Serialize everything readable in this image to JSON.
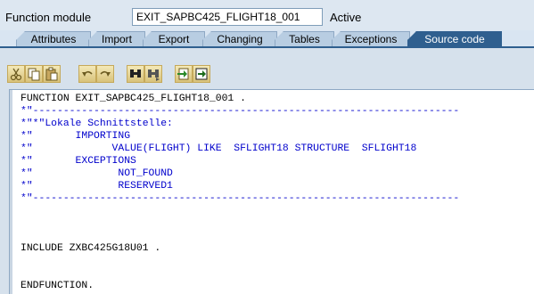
{
  "header": {
    "function_module_label": "Function module",
    "function_module_value": "EXIT_SAPBC425_FLIGHT18_001",
    "status": "Active"
  },
  "tabs": [
    {
      "label": "Attributes"
    },
    {
      "label": "Import"
    },
    {
      "label": "Export"
    },
    {
      "label": "Changing"
    },
    {
      "label": "Tables"
    },
    {
      "label": "Exceptions"
    },
    {
      "label": "Source code",
      "active": true
    }
  ],
  "toolbar": {
    "buttons": [
      "cut-icon",
      "copy-icon",
      "paste-icon",
      "undo-icon",
      "redo-icon",
      "find-icon",
      "find-next-icon",
      "insert-statement-icon",
      "pattern-icon"
    ]
  },
  "code": {
    "lines": [
      {
        "text": "FUNCTION EXIT_SAPBC425_FLIGHT18_001 .",
        "type": "kw"
      },
      {
        "text": "*\"----------------------------------------------------------------------",
        "type": "cm"
      },
      {
        "text": "*\"*\"Lokale Schnittstelle:",
        "type": "cm"
      },
      {
        "text": "*\"       IMPORTING",
        "type": "cm"
      },
      {
        "text": "*\"             VALUE(FLIGHT) LIKE  SFLIGHT18 STRUCTURE  SFLIGHT18",
        "type": "cm"
      },
      {
        "text": "*\"       EXCEPTIONS",
        "type": "cm"
      },
      {
        "text": "*\"              NOT_FOUND",
        "type": "cm"
      },
      {
        "text": "*\"              RESERVED1",
        "type": "cm"
      },
      {
        "text": "*\"----------------------------------------------------------------------",
        "type": "cm"
      },
      {
        "text": "",
        "type": "kw"
      },
      {
        "text": "",
        "type": "kw"
      },
      {
        "text": "",
        "type": "kw"
      },
      {
        "text": "INCLUDE ZXBC425G18U01 .",
        "type": "kw"
      },
      {
        "text": "",
        "type": "kw"
      },
      {
        "text": "",
        "type": "kw"
      },
      {
        "text": "ENDFUNCTION.",
        "type": "kw"
      }
    ]
  }
}
